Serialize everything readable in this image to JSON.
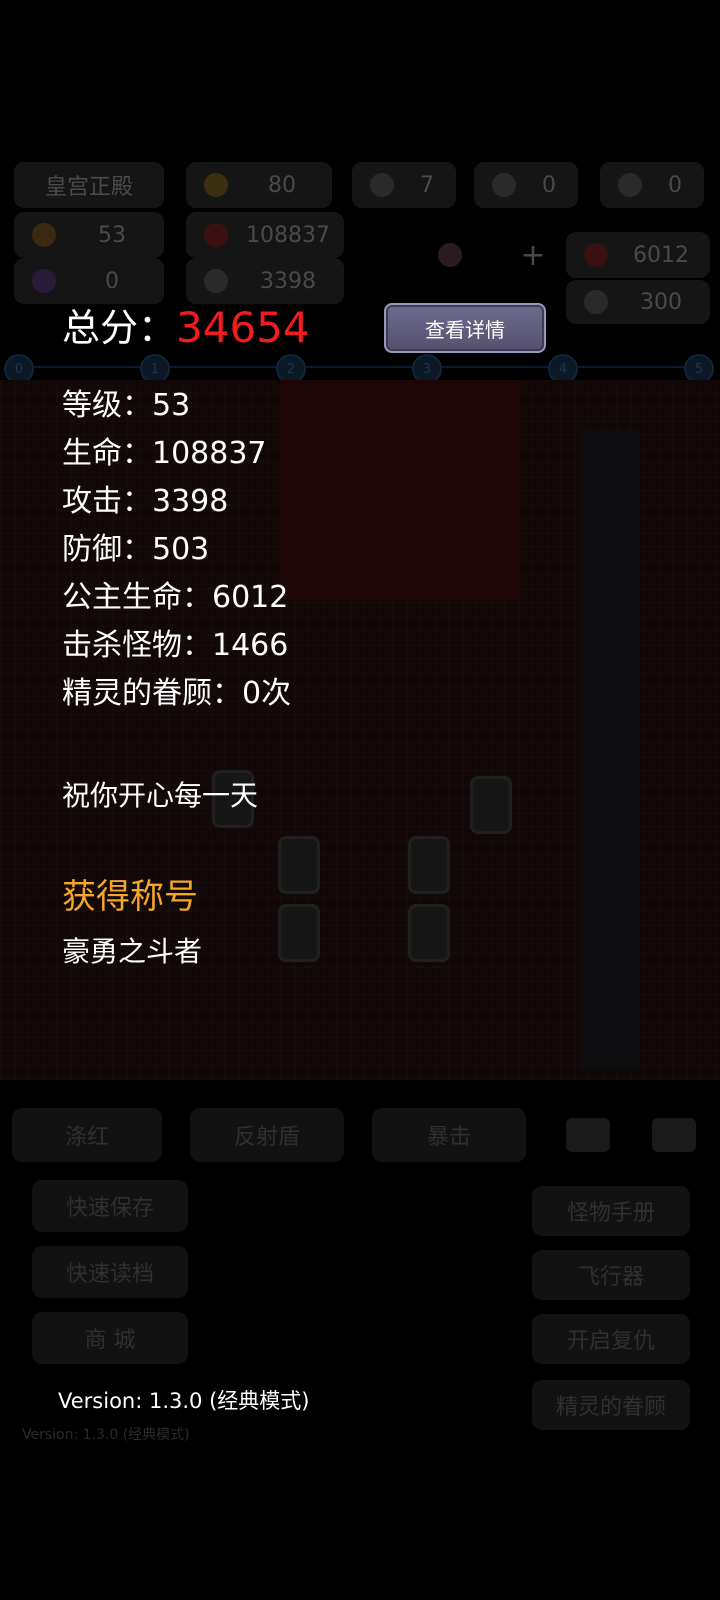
{
  "background": {
    "hud": {
      "location": "皇宫正殿",
      "gold": "80",
      "key_yellow": "7",
      "key_blue": "0",
      "key_red": "0",
      "level": "53",
      "hp": "108837",
      "exp": "0",
      "attack": "3398",
      "princess_hp": "6012",
      "defense": "300"
    },
    "floor_nodes": [
      "0",
      "1",
      "2",
      "3",
      "4",
      "5"
    ],
    "skills": [
      "涤红",
      "反射盾",
      "暴击"
    ],
    "left_buttons": [
      "快速保存",
      "快速读档",
      "商 城"
    ],
    "right_buttons": [
      "怪物手册",
      "飞行器",
      "开启复仇",
      "精灵的眷顾"
    ],
    "version": "Version: 1.3.0 (经典模式)"
  },
  "overlay": {
    "score_label": "总分：",
    "score_value": "34654",
    "detail_button": "查看详情",
    "stats": [
      "等级：53",
      "生命：108837",
      "攻击：3398",
      "防御：503",
      "公主生命：6012",
      "击杀怪物：1466",
      "精灵的眷顾：0次"
    ],
    "greeting": "祝你开心每一天",
    "title_heading": "获得称号",
    "title_name": "豪勇之斗者",
    "version": "Version: 1.3.0 (经典模式)"
  },
  "colors": {
    "score_red": "#f31b1b",
    "title_orange": "#f5a623",
    "button_purple": "#6e6a8e"
  }
}
